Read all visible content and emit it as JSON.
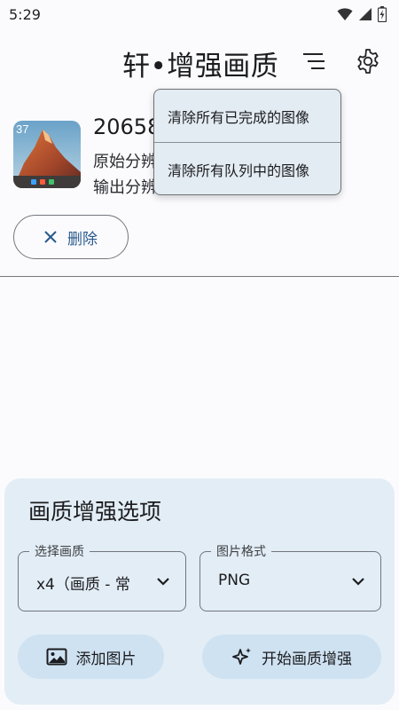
{
  "status_bar": {
    "time": "5:29"
  },
  "app_bar": {
    "title": "轩•增强画质"
  },
  "queue_item": {
    "title": "20658",
    "original_resolution_label": "原始分辨",
    "output_resolution_label": "输出分辨",
    "thumbnail_badge": "37",
    "delete_label": "删除"
  },
  "overflow_menu": {
    "items": [
      {
        "label": "清除所有已完成的图像"
      },
      {
        "label": "清除所有队列中的图像"
      }
    ]
  },
  "options": {
    "title": "画质增强选项",
    "quality_field": {
      "label": "选择画质",
      "value": "x4（画质 - 常"
    },
    "format_field": {
      "label": "图片格式",
      "value": "PNG"
    },
    "add_image_label": "添加图片",
    "start_label": "开始画质增强"
  },
  "colors": {
    "accent_text": "#2a5a8c",
    "card_background": "#e3edf5",
    "button_fill": "#cfe2f2",
    "menu_background": "#e3ecf2"
  }
}
